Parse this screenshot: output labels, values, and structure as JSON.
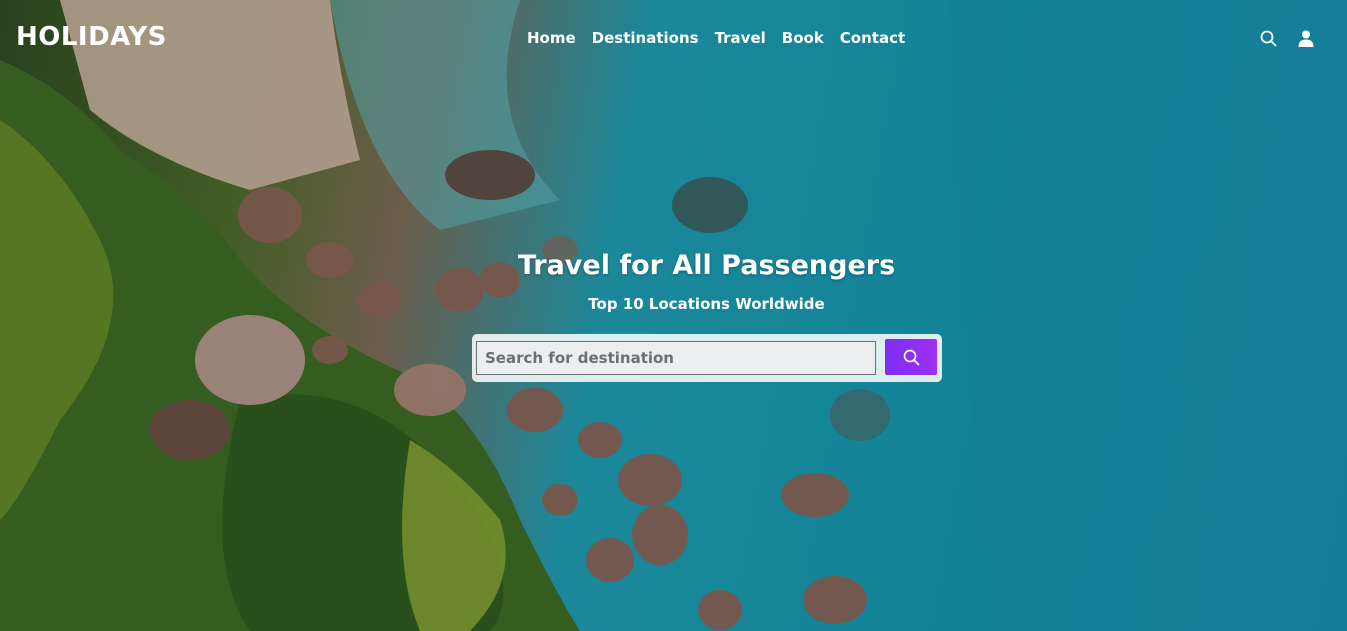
{
  "brand": {
    "logo_text": "HOLIDAYS"
  },
  "nav": {
    "links": [
      "Home",
      "Destinations",
      "Travel",
      "Book",
      "Contact"
    ],
    "icons": [
      "search-icon",
      "user-icon"
    ]
  },
  "hero": {
    "title": "Travel for All Passengers",
    "subtitle": "Top 10 Locations Worldwide"
  },
  "search": {
    "placeholder": "Search for destination",
    "value": "",
    "button_icon": "search-icon"
  },
  "colors": {
    "accent": "#8a2ff3",
    "text": "#ffffff",
    "sea": "#1596ad"
  }
}
